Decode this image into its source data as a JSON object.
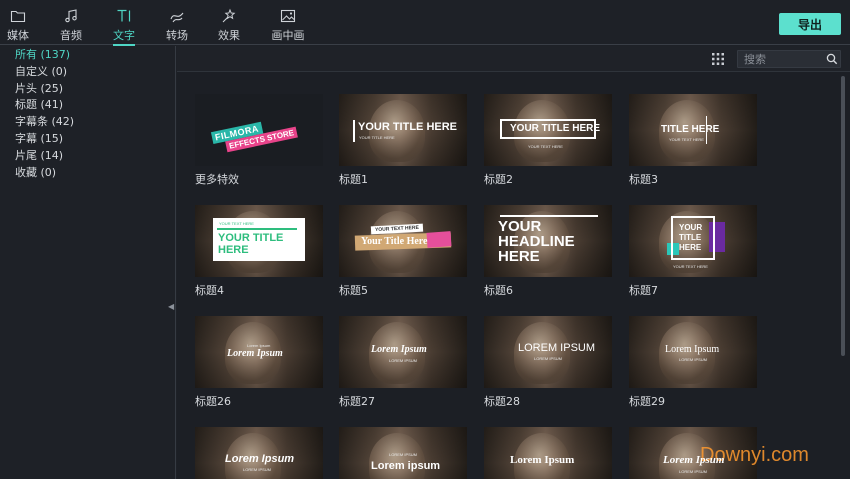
{
  "tabs": [
    {
      "label": "媒体",
      "icon": "folder-icon"
    },
    {
      "label": "音频",
      "icon": "music-note-icon"
    },
    {
      "label": "文字",
      "icon": "text-icon"
    },
    {
      "label": "转场",
      "icon": "transition-icon"
    },
    {
      "label": "效果",
      "icon": "effects-icon"
    },
    {
      "label": "画中画",
      "icon": "picture-icon"
    }
  ],
  "export_label": "导出",
  "categories": [
    {
      "label": "所有 (137)"
    },
    {
      "label": "自定义 (0)"
    },
    {
      "label": "片头 (25)"
    },
    {
      "label": "标题 (41)"
    },
    {
      "label": "字幕条 (42)"
    },
    {
      "label": "字幕 (15)"
    },
    {
      "label": "片尾 (14)"
    },
    {
      "label": "收藏 (0)"
    }
  ],
  "search": {
    "placeholder": "搜索"
  },
  "cards": [
    {
      "label": "更多特效",
      "lines": [
        "FILMORA",
        "EFFECTS STORE"
      ]
    },
    {
      "label": "标题1",
      "lines": [
        "YOUR TITLE HERE",
        "YOUR TITLE HERE"
      ]
    },
    {
      "label": "标题2",
      "lines": [
        "YOUR TITLE HERE",
        "YOUR TEXT HERE"
      ]
    },
    {
      "label": "标题3",
      "lines": [
        "TITLE HERE",
        "YOUR TEXT HERE"
      ]
    },
    {
      "label": "标题4",
      "lines": [
        "YOUR TEXT HERE",
        "YOUR TITLE",
        "HERE"
      ]
    },
    {
      "label": "标题5",
      "lines": [
        "YOUR TEXT HERE",
        "Your Title Here"
      ]
    },
    {
      "label": "标题6",
      "lines": [
        "YOUR",
        "HEADLINE",
        "HERE"
      ]
    },
    {
      "label": "标题7",
      "lines": [
        "YOUR",
        "TITLE",
        "HERE",
        "YOUR TEXT HERE"
      ]
    },
    {
      "label": "标题26",
      "lines": [
        "Lorem Ipsum",
        "Lorem Ipsum"
      ]
    },
    {
      "label": "标题27",
      "lines": [
        "Lorem Ipsum",
        "LOREM IPSUM"
      ]
    },
    {
      "label": "标题28",
      "lines": [
        "LOREM IPSUM",
        "LOREM IPSUM"
      ]
    },
    {
      "label": "标题29",
      "lines": [
        "Lorem Ipsum",
        "LOREM IPSUM"
      ]
    },
    {
      "label": "",
      "lines": [
        "Lorem Ipsum",
        "LOREM IPSUM"
      ]
    },
    {
      "label": "",
      "lines": [
        "LOREM IPSUM",
        "Lorem ipsum"
      ]
    },
    {
      "label": "",
      "lines": [
        "Lorem Ipsum"
      ]
    },
    {
      "label": "",
      "lines": [
        "Lorem Ipsum",
        "LOREM IPSUM"
      ]
    }
  ],
  "watermark": "Downyi.com",
  "colors": {
    "accent": "#4fd6c5",
    "export_button": "#5ce0ce",
    "background": "#1e2127",
    "watermark": "#ff9a2e"
  }
}
